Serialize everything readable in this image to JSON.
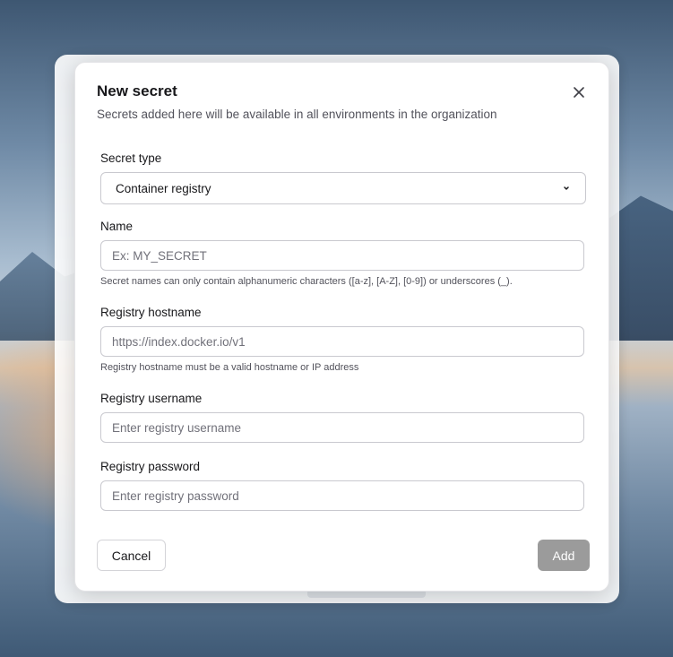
{
  "dialog": {
    "title": "New secret",
    "subtitle": "Secrets added here will be available in all environments in the organization"
  },
  "secret_type": {
    "label": "Secret type",
    "value": "Container registry"
  },
  "name": {
    "label": "Name",
    "placeholder": "Ex: MY_SECRET",
    "hint": "Secret names can only contain alphanumeric characters ([a-z], [A-Z], [0-9]) or underscores (_)."
  },
  "registry_hostname": {
    "label": "Registry hostname",
    "placeholder": "https://index.docker.io/v1",
    "hint": "Registry hostname must be a valid hostname or IP address"
  },
  "registry_username": {
    "label": "Registry username",
    "placeholder": "Enter registry username"
  },
  "registry_password": {
    "label": "Registry password",
    "placeholder": "Enter registry password"
  },
  "actions": {
    "cancel": "Cancel",
    "add": "Add"
  },
  "icons": {
    "close": "close-icon",
    "dropdown": "chevron-down-icon"
  },
  "colors": {
    "add_button_disabled": "#9b9b9b",
    "text_primary": "#18181b",
    "text_muted": "#52525b"
  }
}
